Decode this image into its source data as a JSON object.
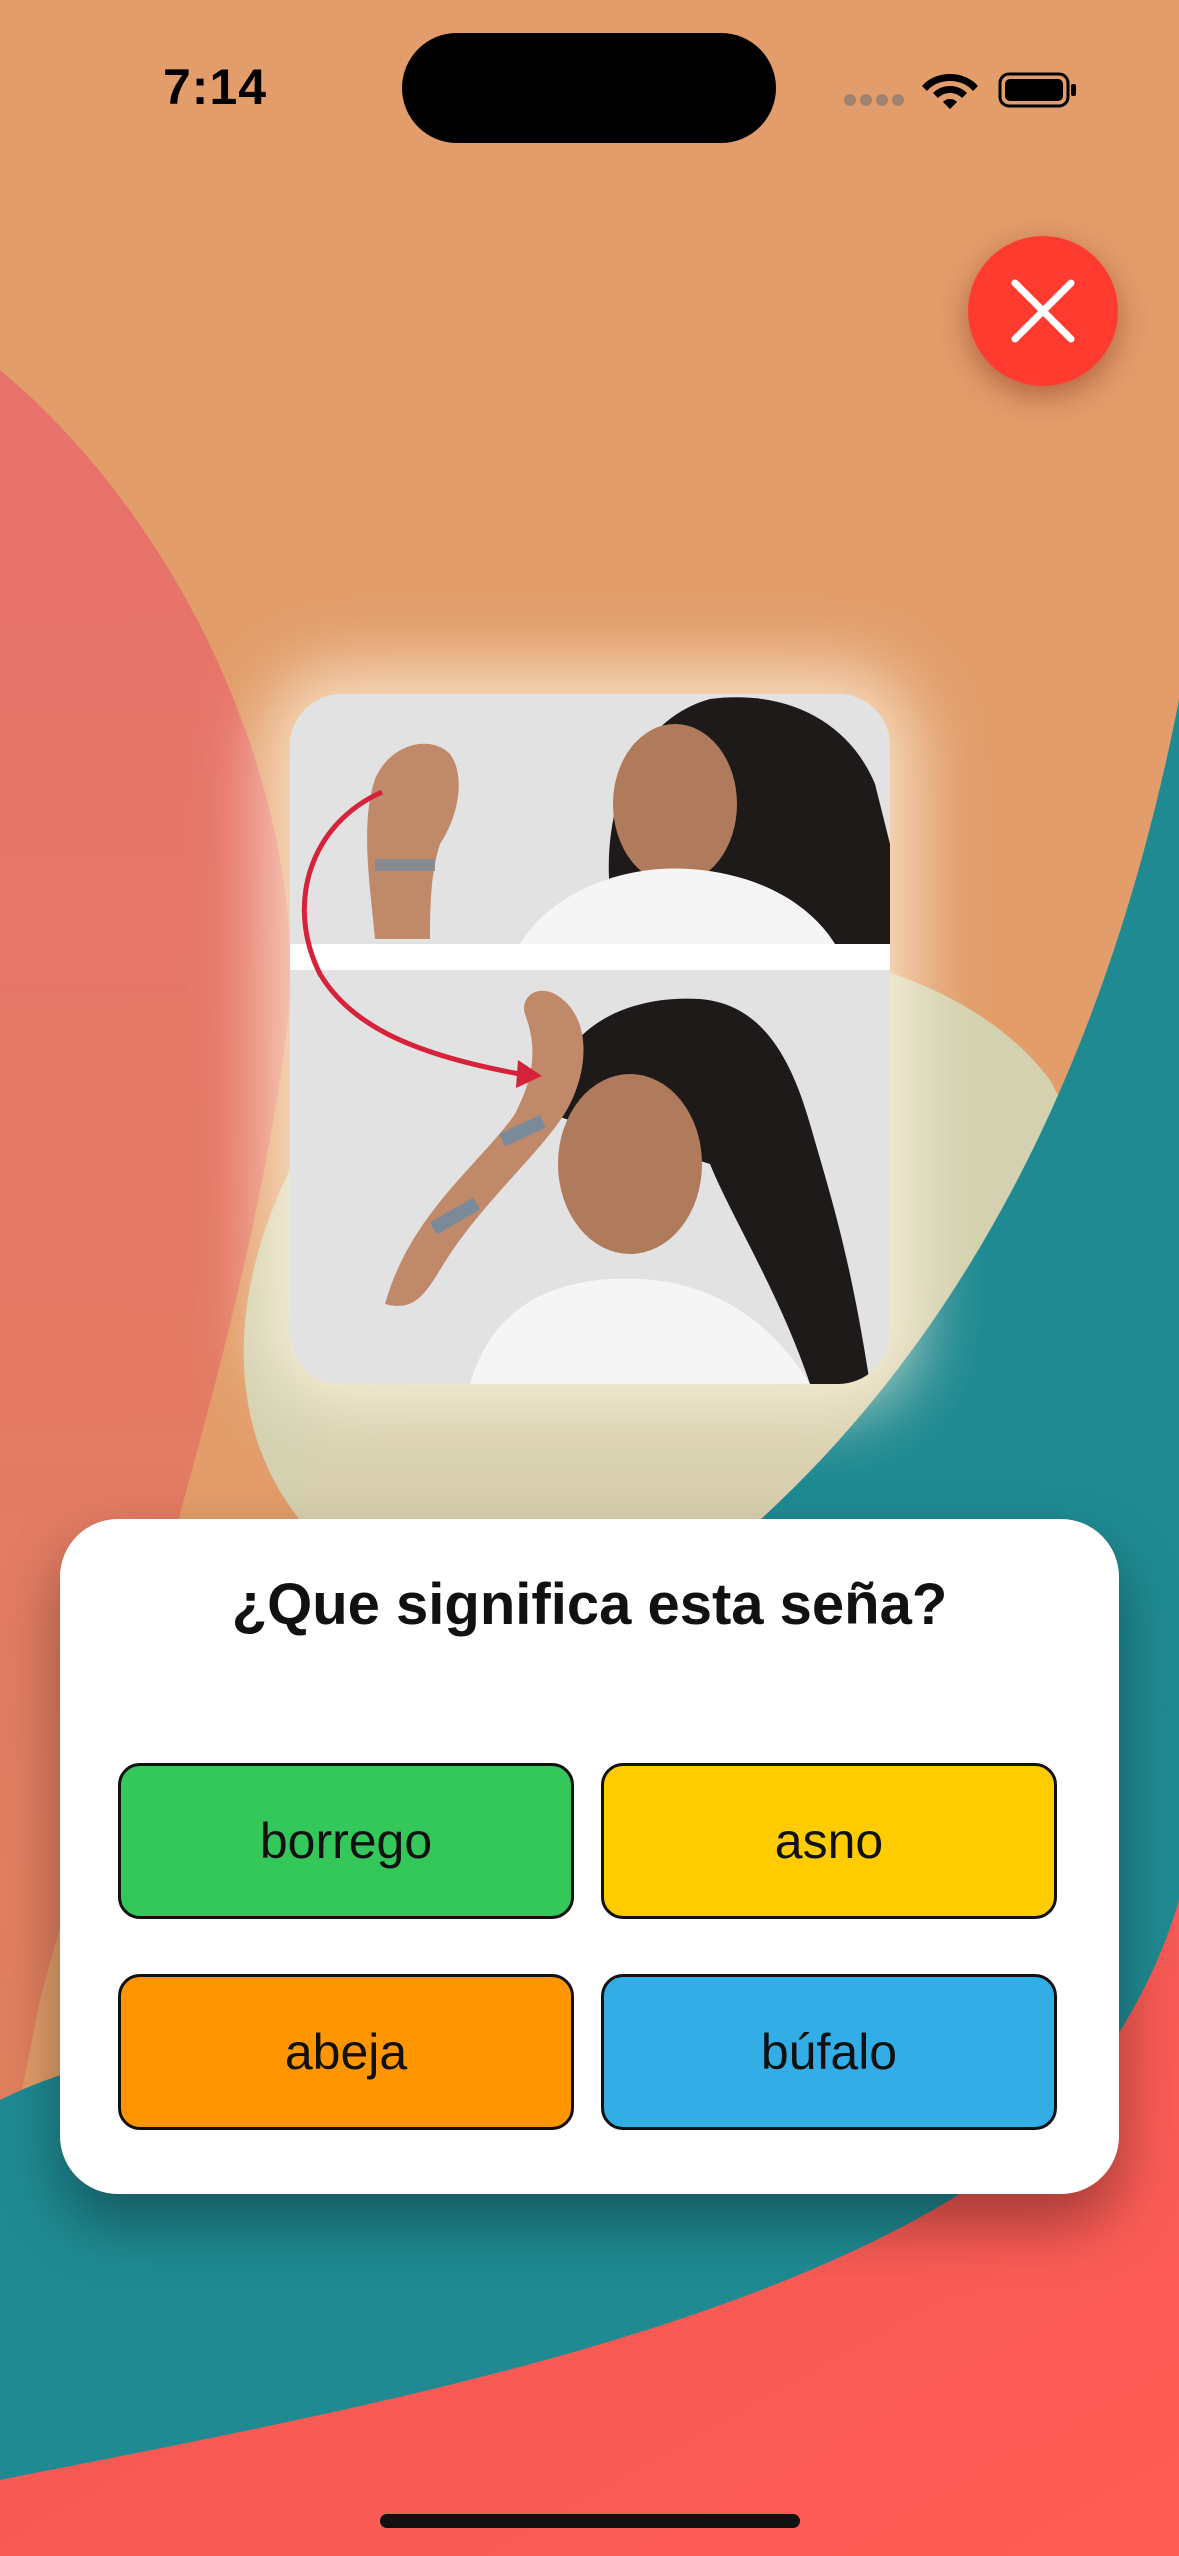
{
  "status_bar": {
    "time": "7:14",
    "icons": [
      "cellular-signal-icon",
      "wifi-icon",
      "battery-icon"
    ]
  },
  "close_button": {
    "icon": "close-icon",
    "color": "#ff3b30"
  },
  "sign_image": {
    "description_icon": "sign-language-photo",
    "arrow_color": "#d6223a"
  },
  "quiz": {
    "question": "¿Que significa esta seña?",
    "answers": [
      {
        "label": "borrego",
        "color": "#34c759"
      },
      {
        "label": "asno",
        "color": "#ffcc00"
      },
      {
        "label": "abeja",
        "color": "#ff9500"
      },
      {
        "label": "búfalo",
        "color": "#32ade6"
      }
    ]
  },
  "colors": {
    "background_orange": "#e29d6a",
    "background_red": "#e06a62",
    "background_teal": "#1f8a92",
    "background_coral": "#ff5a52"
  }
}
